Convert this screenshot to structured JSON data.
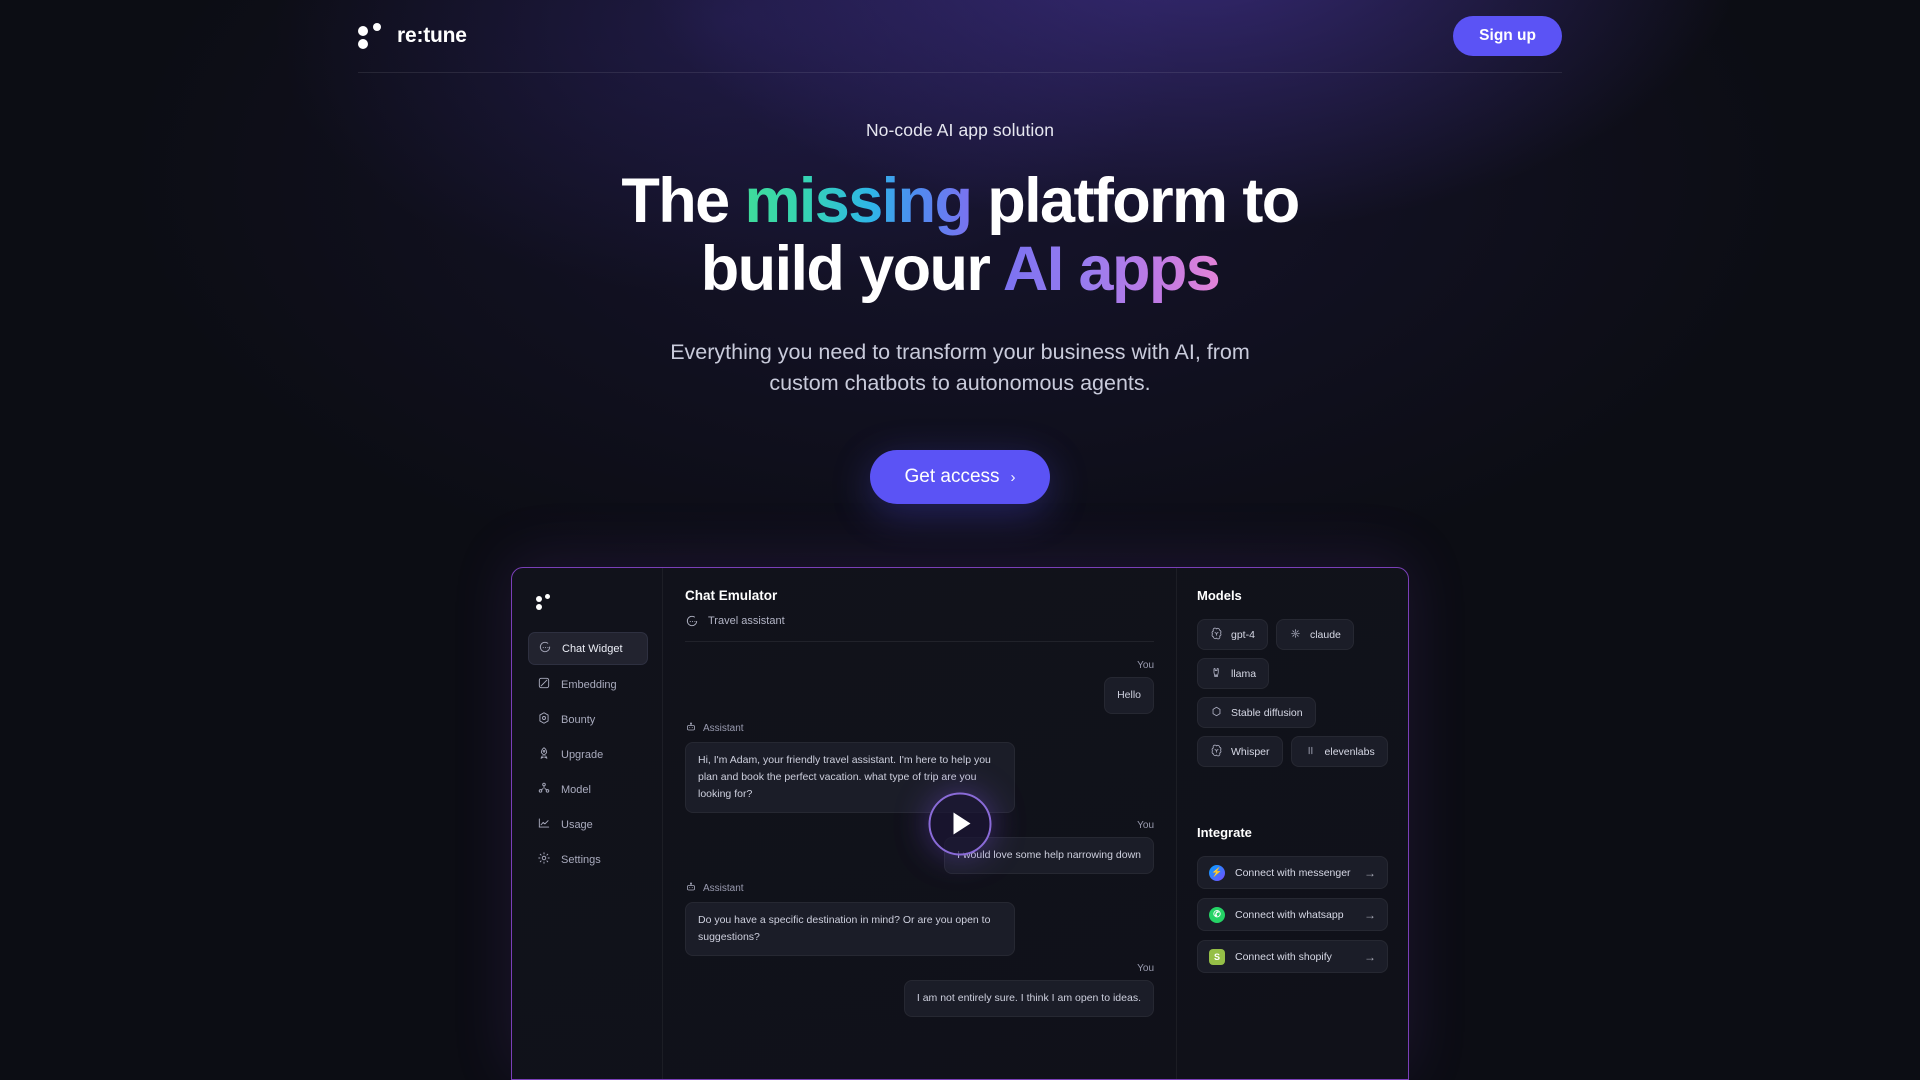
{
  "header": {
    "brand_name": "re:tune",
    "logo_icon": "retune-dots-logo-icon",
    "signup_label": "Sign up"
  },
  "hero": {
    "eyebrow": "No-code AI app solution",
    "headline_line1_a": "The ",
    "headline_line1_grad": "missing",
    "headline_line1_b": " platform to",
    "headline_line2_a": "build your ",
    "headline_line2_grad": "AI apps",
    "subhead_line1": "Everything you need to transform your business with AI, from",
    "subhead_line2": "custom chatbots to autonomous agents.",
    "cta_label": "Get access",
    "cta_chevron": "›",
    "colors": {
      "accent": "#5b53f5",
      "grad_green": "#3fdc9a",
      "grad_cyan": "#2fb5e8",
      "grad_violet": "#7b72f0",
      "grad_pink": "#e383d8",
      "page_bg": "#0c0d14"
    }
  },
  "preview": {
    "logo_icon": "retune-dots-logo-icon",
    "border_color": "#7a3fb8",
    "sidebar": [
      {
        "label": "Chat Widget",
        "icon": "chat-bubble-icon",
        "active": true
      },
      {
        "label": "Embedding",
        "icon": "embedding-icon",
        "active": false
      },
      {
        "label": "Bounty",
        "icon": "bounty-icon",
        "active": false
      },
      {
        "label": "Upgrade",
        "icon": "rocket-icon",
        "active": false
      },
      {
        "label": "Model",
        "icon": "model-nodes-icon",
        "active": false
      },
      {
        "label": "Usage",
        "icon": "chart-line-icon",
        "active": false
      },
      {
        "label": "Settings",
        "icon": "gear-icon",
        "active": false
      }
    ],
    "chat": {
      "title": "Chat Emulator",
      "assistant_name": "Travel assistant",
      "assistant_icon": "chat-bubble-icon",
      "bot_icon": "robot-icon",
      "messages": [
        {
          "who": "You",
          "side": "right",
          "text": "Hello"
        },
        {
          "who": "Assistant",
          "side": "left",
          "text": "Hi, I'm Adam, your friendly travel assistant. I'm here to help you plan and book the perfect vacation. what type of trip are you looking for?"
        },
        {
          "who": "You",
          "side": "right",
          "text": "I would love some help narrowing down"
        },
        {
          "who": "Assistant",
          "side": "left",
          "text": "Do you have a specific destination in mind? Or are you open to suggestions?"
        },
        {
          "who": "You",
          "side": "right",
          "text": "I am not entirely sure. I think I am open to ideas."
        }
      ]
    },
    "models": {
      "title": "Models",
      "items": [
        {
          "label": "gpt-4",
          "icon": "openai-icon"
        },
        {
          "label": "claude",
          "icon": "claude-burst-icon"
        },
        {
          "label": "llama",
          "icon": "llama-icon"
        },
        {
          "label": "Stable diffusion",
          "icon": "stable-diffusion-icon"
        },
        {
          "label": "Whisper",
          "icon": "openai-icon"
        },
        {
          "label": "elevenlabs",
          "icon": "elevenlabs-bars-icon"
        }
      ]
    },
    "integrate": {
      "title": "Integrate",
      "items": [
        {
          "label": "Connect with messenger",
          "icon": "messenger-icon",
          "arrow": "→"
        },
        {
          "label": "Connect with whatsapp",
          "icon": "whatsapp-icon",
          "arrow": "→"
        },
        {
          "label": "Connect with shopify",
          "icon": "shopify-icon",
          "arrow": "→"
        }
      ]
    },
    "play_button": "play-icon"
  }
}
